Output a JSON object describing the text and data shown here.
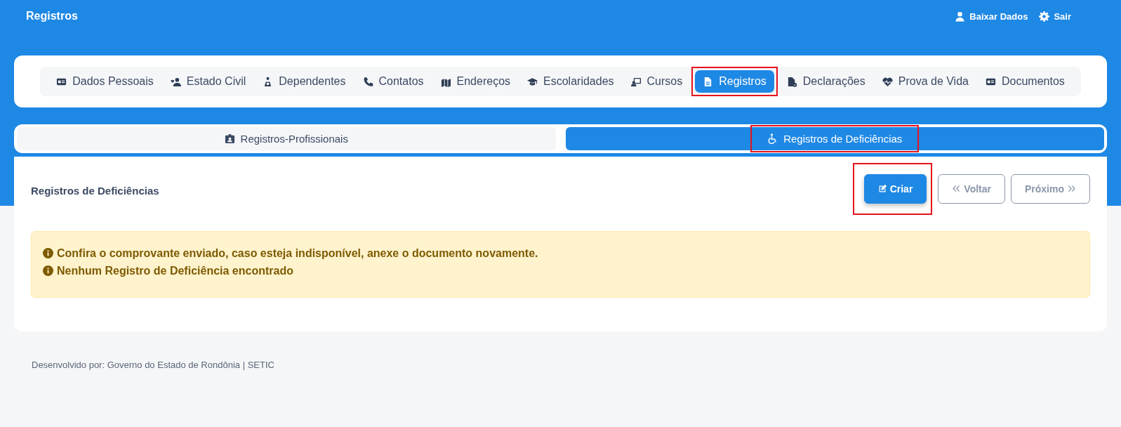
{
  "header": {
    "title": "Registros",
    "actions": [
      {
        "label": "Baixar Dados",
        "kind": "user"
      },
      {
        "label": "Sair",
        "kind": "gear"
      }
    ]
  },
  "nav_tabs": [
    {
      "label": "Dados Pessoais",
      "kind": "idcard",
      "selected": false,
      "highlighted": false
    },
    {
      "label": "Estado Civil",
      "kind": "couple",
      "selected": false,
      "highlighted": false
    },
    {
      "label": "Dependentes",
      "kind": "child",
      "selected": false,
      "highlighted": false
    },
    {
      "label": "Contatos",
      "kind": "phone",
      "selected": false,
      "highlighted": false
    },
    {
      "label": "Endereços",
      "kind": "map",
      "selected": false,
      "highlighted": false
    },
    {
      "label": "Escolaridades",
      "kind": "cap",
      "selected": false,
      "highlighted": false
    },
    {
      "label": "Cursos",
      "kind": "teacher",
      "selected": false,
      "highlighted": false
    },
    {
      "label": "Registros",
      "kind": "file",
      "selected": true,
      "highlighted": true
    },
    {
      "label": "Declarações",
      "kind": "filecheck",
      "selected": false,
      "highlighted": false
    },
    {
      "label": "Prova de Vida",
      "kind": "heart",
      "selected": false,
      "highlighted": false
    },
    {
      "label": "Documentos",
      "kind": "idcard",
      "selected": false,
      "highlighted": false
    }
  ],
  "sub_tabs": [
    {
      "label": "Registros-Profissionais",
      "kind": "badge",
      "selected": false,
      "highlighted": false
    },
    {
      "label": "Registros de Deficiências",
      "kind": "wheelchair",
      "selected": true,
      "highlighted": true
    }
  ],
  "panel": {
    "title": "Registros de Deficiências",
    "buttons": [
      {
        "label": "Criar",
        "kind": "create",
        "disabled": false,
        "highlighted": true
      },
      {
        "label": "Voltar",
        "kind": "back",
        "disabled": true,
        "highlighted": false
      },
      {
        "label": "Próximo",
        "kind": "next",
        "disabled": true,
        "highlighted": false
      }
    ],
    "alert": [
      "Confira o comprovante enviado, caso esteja indisponível, anexe o documento novamente.",
      "Nenhum Registro de Deficiência encontrado"
    ]
  },
  "footer": "Desenvolvido por: Governo do Estado de Rondônia | SETIC"
}
